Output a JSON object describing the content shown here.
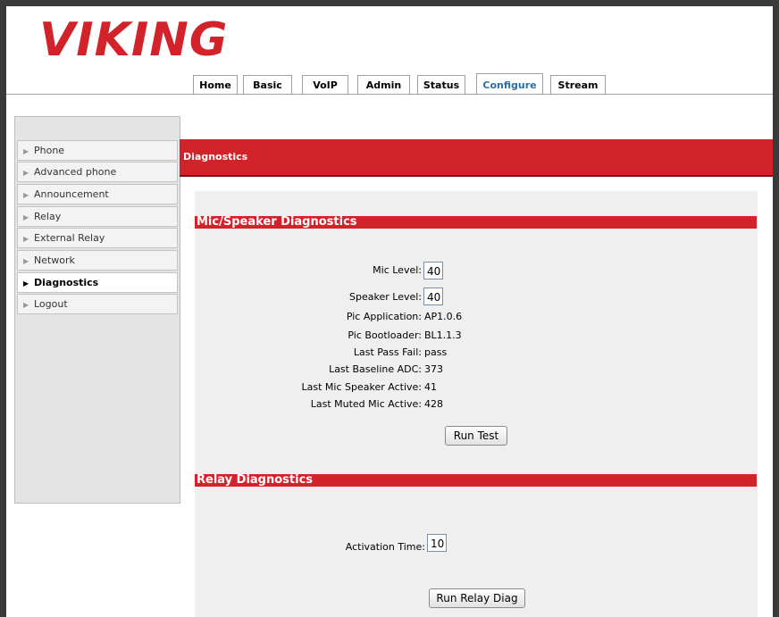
{
  "brand": {
    "logo_text": "VIKING",
    "accent": "#d2232a",
    "tab_active_color": "#2a6fa8"
  },
  "tabs": [
    {
      "label": "Home"
    },
    {
      "label": "Basic"
    },
    {
      "label": "VoIP"
    },
    {
      "label": "Admin"
    },
    {
      "label": "Status"
    },
    {
      "label": "Configure",
      "active": true
    },
    {
      "label": "Stream"
    }
  ],
  "sidebar": {
    "items": [
      {
        "label": "Phone"
      },
      {
        "label": "Advanced phone"
      },
      {
        "label": "Announcement"
      },
      {
        "label": "Relay"
      },
      {
        "label": "External Relay"
      },
      {
        "label": "Network"
      },
      {
        "label": "Diagnostics",
        "active": true
      },
      {
        "label": "Logout"
      }
    ],
    "arrow_icon": "▶"
  },
  "page": {
    "title": "Diagnostics"
  },
  "mic_speaker": {
    "heading": "Mic/Speaker Diagnostics",
    "mic_level": {
      "label": "Mic Level:",
      "value": "40"
    },
    "speaker_level": {
      "label": "Speaker Level:",
      "value": "40"
    },
    "pic_application": {
      "label": "Pic Application:",
      "value": "AP1.0.6"
    },
    "pic_bootloader": {
      "label": "Pic Bootloader:",
      "value": "BL1.1.3"
    },
    "last_pass_fail": {
      "label": "Last Pass Fail:",
      "value": "pass"
    },
    "last_baseline_adc": {
      "label": "Last Baseline ADC:",
      "value": "373"
    },
    "last_mic_speaker_active": {
      "label": "Last Mic Speaker Active:",
      "value": "41"
    },
    "last_muted_mic_active": {
      "label": "Last Muted Mic Active:",
      "value": "428"
    },
    "run_button": "Run Test"
  },
  "relay": {
    "heading": "Relay Diagnostics",
    "activation_time": {
      "label": "Activation Time:",
      "value": "10"
    },
    "run_button": "Run Relay Diag"
  }
}
